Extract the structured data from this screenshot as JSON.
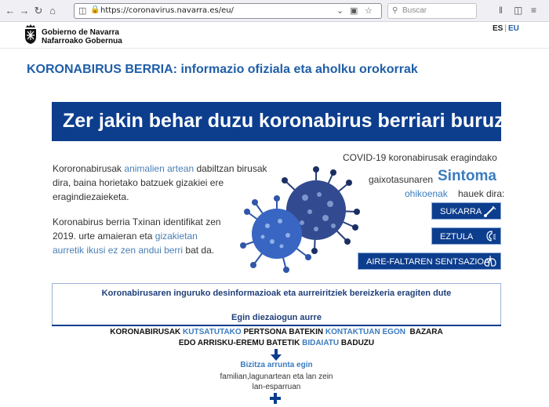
{
  "browser": {
    "url": "https://coronavirus.navarra.es/eu/",
    "search_placeholder": "Buscar"
  },
  "site": {
    "gov_line1": "Gobierno de Navarra",
    "gov_line2": "Nafarroako Gobernua",
    "lang_es": "ES",
    "lang_sep": "|",
    "lang_eu": "EU"
  },
  "page": {
    "title": "KORONABIRUS BERRIA: informazio ofiziala eta aholku orokorrak",
    "banner": "Zer jakin behar duzu koronabirus berriari buruz"
  },
  "intro": {
    "p1_a": "Kororonabirusak ",
    "p1_hl": "animalien artean",
    "p1_b": " dabiltzan birusak",
    "p1_line2": "dira, baina horietako batzuek gizakiei ere",
    "p1_line3": "eragindiezaieketa.",
    "p2_line1": "Koronabirus berria Txinan identifikat zen",
    "p2_a": "2019. urte amaieran eta ",
    "p2_hl": "gizakietan",
    "p2_hl2": "aurretik ikusi ez zen andui berri",
    "p2_b": " bat da."
  },
  "symptoms": {
    "heading1": "COVID-19 koronabirusak eragindako",
    "heading2": "gaixotasunaren",
    "sintoma": "Sintoma",
    "ohikoenak": "ohikoenak",
    "hauek": "hauek dira:",
    "items": [
      {
        "label": "SUKARRA",
        "icon": "thermometer-icon"
      },
      {
        "label": "EZTULA",
        "icon": "cough-icon"
      },
      {
        "label": "AIRE-FALTAREN SENTSAZIOA",
        "icon": "lungs-icon"
      }
    ]
  },
  "myths": {
    "line1": "Koronabirusaren inguruko desinformazioak eta aurreiritziek bereizkeria eragiten dute",
    "line2": "Egin diezaiogun aurre"
  },
  "contact": {
    "l1_a": "KORONABIRUSAK ",
    "l1_b": "KUTSATUTAKO",
    "l1_c": " PERTSONA BATEKIN ",
    "l1_d": "KONTAKTUAN EGON",
    "l1_e": "  BAZARA",
    "l2_a": "EDO ARRISKU-EREMU BATETIK ",
    "l2_b": "BIDAIATU",
    "l2_c": " BADUZU",
    "bizitza": "Bizitza arrunta egin",
    "familian1": "familian,lagunartean eta lan zein",
    "familian2": "lan-esparruan"
  },
  "colors": {
    "brand_blue": "#0d3d8d",
    "link_blue": "#1f5ea8",
    "accent_blue": "#3a7bbf"
  }
}
